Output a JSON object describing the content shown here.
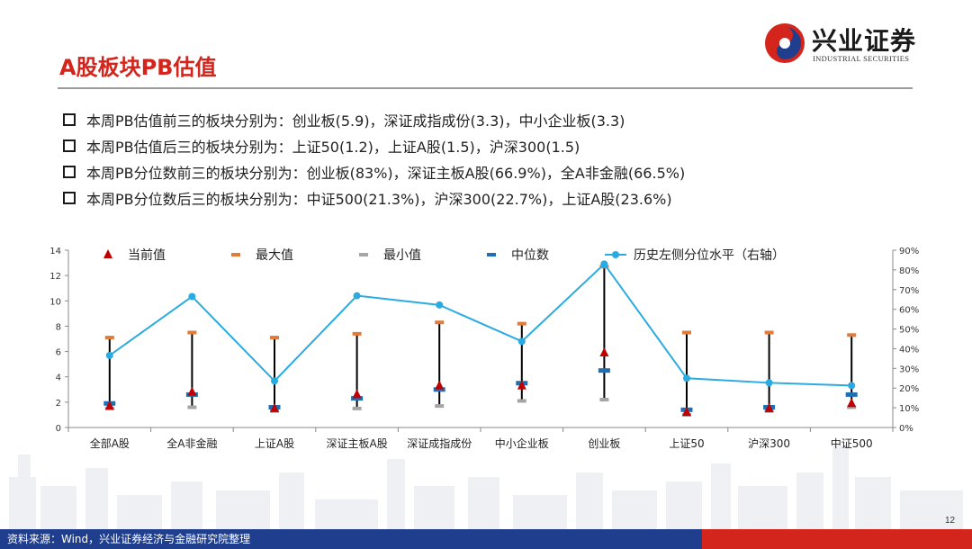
{
  "header": {
    "title": "A股板块PB估值",
    "logo_cn": "兴业证券",
    "logo_en": "INDUSTRIAL SECURITIES"
  },
  "bullets": [
    "本周PB估值前三的板块分别为：创业板(5.9)，深证成指成份(3.3)，中小企业板(3.3)",
    "本周PB估值后三的板块分别为：上证50(1.2)，上证A股(1.5)，沪深300(1.5)",
    "本周PB分位数前三的板块分别为：创业板(83%)，深证主板A股(66.9%)，全A非金融(66.5%)",
    "本周PB分位数后三的板块分别为：中证500(21.3%)，沪深300(22.7%)，上证A股(23.6%)"
  ],
  "chart_data": {
    "type": "line",
    "categories": [
      "全部A股",
      "全A非金融",
      "上证A股",
      "深证主板A股",
      "深证成指成份",
      "中小企业板",
      "创业板",
      "上证50",
      "沪深300",
      "中证500"
    ],
    "series": [
      {
        "name": "当前值",
        "marker": "triangle",
        "color": "#c00000",
        "axis": "left",
        "values": [
          1.7,
          2.8,
          1.5,
          2.6,
          3.3,
          3.3,
          5.9,
          1.2,
          1.5,
          1.9
        ]
      },
      {
        "name": "最大值",
        "marker": "dash",
        "color": "#e07b39",
        "axis": "left",
        "values": [
          7.1,
          7.5,
          7.1,
          7.4,
          8.3,
          8.2,
          12.7,
          7.5,
          7.5,
          7.3
        ]
      },
      {
        "name": "最小值",
        "marker": "dash",
        "color": "#a5a5a5",
        "axis": "left",
        "values": [
          1.5,
          1.6,
          1.3,
          1.5,
          1.7,
          2.1,
          2.2,
          1.0,
          1.3,
          1.6
        ]
      },
      {
        "name": "中位数",
        "marker": "dash",
        "color": "#1f6fb5",
        "axis": "left",
        "values": [
          1.9,
          2.6,
          1.6,
          2.3,
          3.0,
          3.5,
          4.5,
          1.4,
          1.6,
          2.6
        ]
      },
      {
        "name": "历史左侧分位水平（右轴）",
        "marker": "circle-line",
        "color": "#29abe2",
        "axis": "right",
        "values": [
          0.366,
          0.665,
          0.236,
          0.669,
          0.622,
          0.437,
          0.83,
          0.25,
          0.227,
          0.213
        ]
      }
    ],
    "ylim_left": [
      0,
      14
    ],
    "yticks_left": [
      "0",
      "2",
      "4",
      "6",
      "8",
      "10",
      "12",
      "14"
    ],
    "ylim_right": [
      0,
      0.9
    ],
    "yticks_right": [
      "0%",
      "10%",
      "20%",
      "30%",
      "40%",
      "50%",
      "60%",
      "70%",
      "80%",
      "90%"
    ],
    "range_line_color": "#000000",
    "legend_position": "top",
    "grid": false
  },
  "footer": {
    "source": "资料来源：Wind，兴业证券经济与金融研究院整理",
    "page_number": "12"
  },
  "colors": {
    "title": "#d4251c",
    "footer_blue": "#1f3f8e",
    "footer_red": "#d4251c"
  }
}
